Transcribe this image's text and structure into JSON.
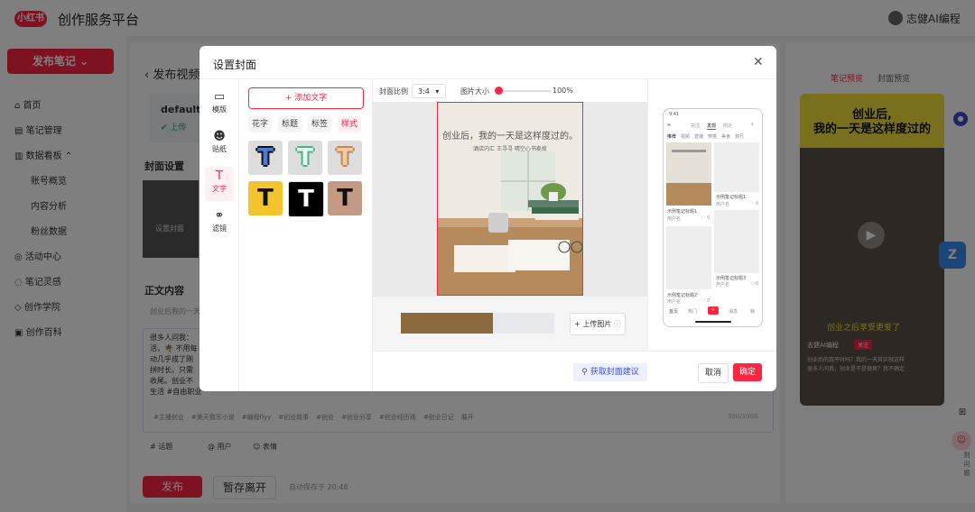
{
  "header": {
    "logo_text": "小红书",
    "platform_title": "创作服务平台",
    "user_name": "志健AI编程"
  },
  "sidebar": {
    "publish_button": "发布笔记",
    "items": [
      {
        "label": "首页"
      },
      {
        "label": "笔记管理"
      },
      {
        "label": "数据看板"
      },
      {
        "label": "账号概览"
      },
      {
        "label": "内容分析"
      },
      {
        "label": "粉丝数据"
      },
      {
        "label": "活动中心"
      },
      {
        "label": "笔记灵感"
      },
      {
        "label": "创作学院"
      },
      {
        "label": "创作百科"
      }
    ]
  },
  "main": {
    "back_title": "发布视频",
    "file_name": "default.m",
    "upload_status": "上传",
    "cover_section": "封面设置",
    "cover_button": "设置封面",
    "body_section": "正文内容",
    "title_placeholder": "创业后我的一天是这样度过的",
    "text_lines": [
      "很多人问我：",
      "活，🌴 不用每",
      "动几乎成了刚",
      "拼时长。只需",
      "收尾。创业不",
      "生活 #自由职业"
    ],
    "tags": [
      "#主播创业",
      "#美天我写小说",
      "#编程flyy",
      "#创业故事",
      "#创业",
      "#创业分享",
      "#创业经历观",
      "#创业日记",
      "展开"
    ],
    "char_count": "300/1000",
    "topic_button": "# 话题",
    "user_button": "@ 用户",
    "emoji_button": "☺ 表情",
    "publish": "发布",
    "save_draft": "暂存离开",
    "autosave": "自动保存于 20:48"
  },
  "preview_panel": {
    "tab_note": "笔记预览",
    "tab_cover": "封面预览",
    "video_title_line1": "创业后,",
    "video_title_line2": "我的一天是这样度过的",
    "caption": "创业之后享受更爱了",
    "author": "志健AI编程",
    "follow": "关注",
    "desc": "创业后的我平时吗？我的一天其实就这样",
    "desc2": "很多人问我，创业是不是很爽？我不确定"
  },
  "floating": {
    "ask_text": "问题",
    "ask_label": "到\n问\n题"
  },
  "modal": {
    "title": "设置封面",
    "tools": [
      {
        "label": "模版",
        "icon": "template-icon"
      },
      {
        "label": "贴纸",
        "icon": "sticker-icon"
      },
      {
        "label": "文字",
        "icon": "text-icon"
      },
      {
        "label": "滤镜",
        "icon": "filter-icon"
      }
    ],
    "add_text": "添加文字",
    "style_tabs": [
      "花字",
      "标题",
      "标签",
      "样式"
    ],
    "active_style_tab": "样式",
    "ratio_label": "封面比例",
    "ratio_value": "3:4",
    "size_label": "图片大小",
    "size_value": "100%",
    "size_fraction": 0.0,
    "cover_title": "创业后，我的一天是这样度过的。",
    "cover_sub": "酒店内汇 王寻寻  晴空心书麦故",
    "upload_image": "上传图片",
    "get_suggestion": "获取封面建议",
    "cancel": "取消",
    "confirm": "确定",
    "tile_glyph": "T",
    "phone": {
      "time": "9:41",
      "tabs": [
        "关注",
        "发现",
        "附近"
      ],
      "active_tab": "发现",
      "categories": [
        "推荐",
        "视频",
        "直播",
        "穿搭",
        "美食",
        "旅行"
      ],
      "card_title": "示例笔记标题1",
      "card_title2": "示例笔记标题2",
      "card_title3": "示例笔记标题3",
      "card_author": "用户名",
      "card_likes": "0",
      "bottom_nav": [
        "首页",
        "热门",
        "+",
        "消息",
        "我"
      ]
    },
    "colors": {
      "accent": "#ff2442",
      "suggest": "#3a52d6"
    }
  }
}
